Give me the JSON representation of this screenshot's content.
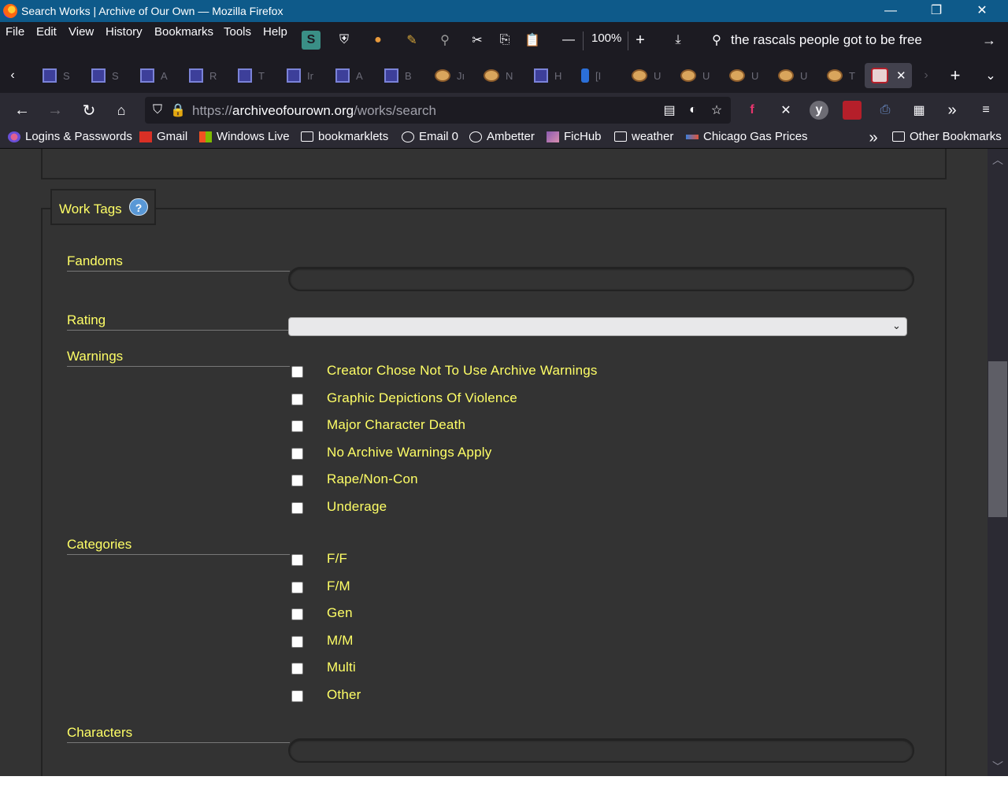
{
  "window": {
    "title": "Search Works | Archive of Our Own — Mozilla Firefox",
    "minimize": "—",
    "restore": "❐",
    "close": "✕"
  },
  "menu": {
    "file": "File",
    "edit": "Edit",
    "view": "View",
    "history": "History",
    "bookmarks": "Bookmarks",
    "tools": "Tools",
    "help": "Help"
  },
  "toolbar": {
    "zoom_level": "100%",
    "search_query": "the rascals people got to be free"
  },
  "tabs": [
    {
      "icon": "ao3-icon",
      "label": "S"
    },
    {
      "icon": "ao3-icon",
      "label": "S"
    },
    {
      "icon": "ao3-icon",
      "label": "A"
    },
    {
      "icon": "ao3-icon",
      "label": "R"
    },
    {
      "icon": "ao3-icon",
      "label": "T"
    },
    {
      "icon": "ao3-icon",
      "label": "Ir"
    },
    {
      "icon": "ao3-icon",
      "label": "A"
    },
    {
      "icon": "ao3-icon",
      "label": "B"
    },
    {
      "icon": "spacebattles-icon",
      "label": "Jı"
    },
    {
      "icon": "spacebattles-icon",
      "label": "N"
    },
    {
      "icon": "ao3-icon",
      "label": "H"
    },
    {
      "icon": "qq-icon",
      "label": "[I"
    },
    {
      "icon": "spacebattles-icon",
      "label": "U"
    },
    {
      "icon": "spacebattles-icon",
      "label": "U"
    },
    {
      "icon": "spacebattles-icon",
      "label": "U"
    },
    {
      "icon": "spacebattles-icon",
      "label": "U"
    },
    {
      "icon": "spacebattles-icon",
      "label": "T"
    }
  ],
  "address": {
    "url_prefix": "https://",
    "url_domain": "archiveofourown.org",
    "url_path": "/works/search"
  },
  "bookmarks": [
    {
      "label": "Logins & Passwords",
      "icon": "key-icon"
    },
    {
      "label": "Gmail",
      "icon": "gmail-icon"
    },
    {
      "label": "Windows Live",
      "icon": "windows-icon"
    },
    {
      "label": "bookmarklets",
      "icon": "folder-icon"
    },
    {
      "label": "Email 0",
      "icon": "globe-icon"
    },
    {
      "label": "Ambetter",
      "icon": "globe-icon"
    },
    {
      "label": "FicHub",
      "icon": "fichub-icon"
    },
    {
      "label": "weather",
      "icon": "folder-icon"
    },
    {
      "label": "Chicago Gas Prices",
      "icon": "gas-icon"
    }
  ],
  "other_bookmarks": "Other Bookmarks",
  "form": {
    "legend": "Work Tags",
    "help": "?",
    "fandoms_label": "Fandoms",
    "fandoms_value": "",
    "rating_label": "Rating",
    "rating_value": "",
    "warnings_label": "Warnings",
    "warnings": [
      "Creator Chose Not To Use Archive Warnings",
      "Graphic Depictions Of Violence",
      "Major Character Death",
      "No Archive Warnings Apply",
      "Rape/Non-Con",
      "Underage"
    ],
    "categories_label": "Categories",
    "categories": [
      "F/F",
      "F/M",
      "Gen",
      "M/M",
      "Multi",
      "Other"
    ],
    "characters_label": "Characters",
    "characters_value": ""
  },
  "colors": {
    "page_bg": "#333333",
    "label_yellow": "#ffff66",
    "title_bar": "#0e5a8a",
    "toolbar_bg": "#1c1b22"
  }
}
